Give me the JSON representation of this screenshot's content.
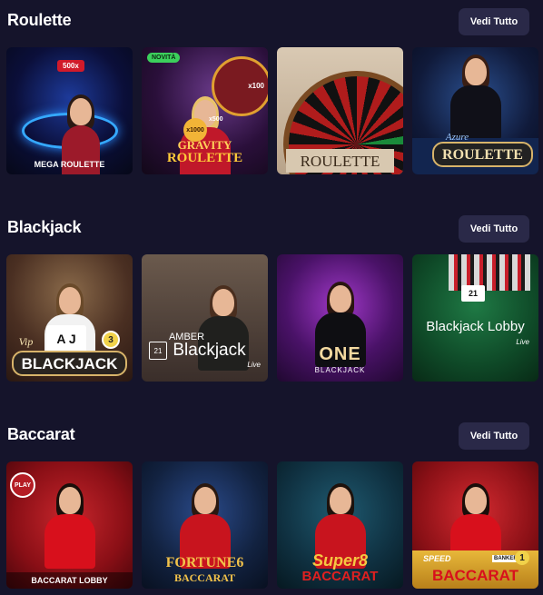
{
  "sections": [
    {
      "title": "Roulette",
      "see_all_label": "Vedi Tutto",
      "games": [
        {
          "name": "MEGA ROULETTE",
          "multiplier": "500x"
        },
        {
          "name_line1": "GRAVITY",
          "name_line2": "ROULETTE",
          "badge": "NOVITÀ",
          "mult_a": "x1000",
          "mult_b": "x500",
          "mult_c": "x100"
        },
        {
          "name": "ROULETTE"
        },
        {
          "name_line1": "Azure",
          "name_line2": "ROULETTE"
        }
      ]
    },
    {
      "title": "Blackjack",
      "see_all_label": "Vedi Tutto",
      "games": [
        {
          "name_line1": "Vip",
          "name_line2": "BLACKJACK",
          "number": "3"
        },
        {
          "name_line1": "AMBER",
          "name_line2": "Blackjack",
          "tag": "Live"
        },
        {
          "name_line1": "ONE",
          "name_line2": "BLACKJACK"
        },
        {
          "name": "Blackjack Lobby",
          "tag": "Live"
        }
      ]
    },
    {
      "title": "Baccarat",
      "see_all_label": "Vedi Tutto",
      "games": [
        {
          "name": "BACCARAT LOBBY",
          "badge": "PLAY"
        },
        {
          "name_line1": "FORTUNE6",
          "name_line2": "BACCARAT"
        },
        {
          "name_line1": "Super8",
          "name_line2": "BACCARAT"
        },
        {
          "name_line1": "SPEED",
          "name_line2": "BACCARAT",
          "sub": "BANKER",
          "number": "1"
        }
      ]
    }
  ]
}
